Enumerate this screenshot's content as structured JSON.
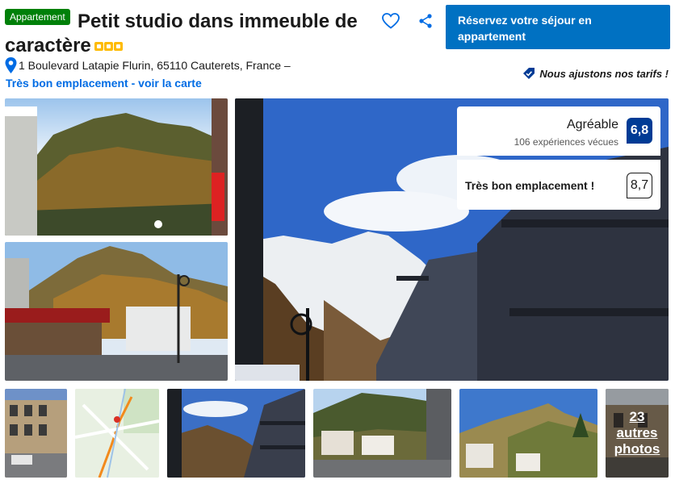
{
  "property": {
    "type_badge": "Appartement",
    "title": "Petit studio dans immeuble de caractère",
    "star_count": 3,
    "address": "1 Boulevard Latapie Flurin, 65110 Cauterets, France –",
    "map_link": "Très bon emplacement - voir la carte"
  },
  "actions": {
    "favorite_icon": "heart-icon",
    "share_icon": "share-icon",
    "reserve_label": "Réservez votre séjour en appartement"
  },
  "price_match": {
    "icon": "tag-check-icon",
    "label": "Nous ajustons nos tarifs !"
  },
  "review": {
    "label": "Agréable",
    "count": "106 expériences vécues",
    "score": "6,8",
    "score_color": "#003b95"
  },
  "location_score": {
    "label": "Très bon emplacement !",
    "score": "8,7"
  },
  "gallery": {
    "more_photos": "23 autres photos",
    "photos": [
      {
        "name": "mountain-autumn"
      },
      {
        "name": "street-brasserie"
      },
      {
        "name": "main-street-snow-peak"
      },
      {
        "name": "building-facade"
      },
      {
        "name": "map-thumbnail"
      },
      {
        "name": "balconies-mountain"
      },
      {
        "name": "town-valley"
      },
      {
        "name": "mountain-village"
      },
      {
        "name": "building-dark"
      }
    ]
  },
  "colors": {
    "brand_blue": "#0071c2",
    "link_blue": "#006ce4",
    "badge_green": "#008009",
    "star_yellow": "#febb02"
  }
}
